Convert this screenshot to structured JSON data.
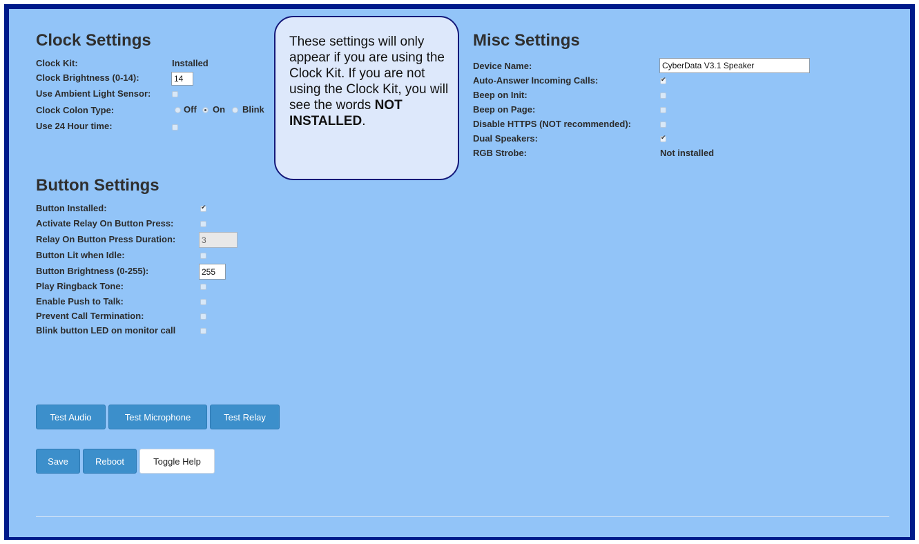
{
  "clock": {
    "title": "Clock Settings",
    "kit_label": "Clock Kit:",
    "kit_value": "Installed",
    "brightness_label": "Clock Brightness (0-14):",
    "brightness_value": "14",
    "ambient_label": "Use Ambient Light Sensor:",
    "ambient_checked": false,
    "colon_label": "Clock Colon Type:",
    "colon_options": [
      "Off",
      "On",
      "Blink"
    ],
    "colon_selected": "On",
    "hour24_label": "Use 24 Hour time:",
    "hour24_checked": false
  },
  "callout": {
    "text": "These settings will only appear if you are using the Clock Kit. If you are not using the Clock Kit, you will see the words ",
    "bold": "NOT INSTALLED",
    "end": "."
  },
  "misc": {
    "title": "Misc Settings",
    "device_name_label": "Device Name:",
    "device_name_value": "CyberData V3.1 Speaker",
    "auto_answer_label": "Auto-Answer Incoming Calls:",
    "auto_answer_checked": true,
    "beep_init_label": "Beep on Init:",
    "beep_init_checked": false,
    "beep_page_label": "Beep on Page:",
    "beep_page_checked": false,
    "disable_https_label": "Disable HTTPS (NOT recommended):",
    "disable_https_checked": false,
    "dual_speakers_label": "Dual Speakers:",
    "dual_speakers_checked": true,
    "rgb_strobe_label": "RGB Strobe:",
    "rgb_strobe_value": "Not installed"
  },
  "button": {
    "title": "Button Settings",
    "installed_label": "Button Installed:",
    "installed_checked": true,
    "relay_press_label": "Activate Relay On Button Press:",
    "relay_press_checked": false,
    "relay_duration_label": "Relay On Button Press Duration:",
    "relay_duration_value": "3",
    "lit_idle_label": "Button Lit when Idle:",
    "lit_idle_checked": false,
    "brightness_label": "Button Brightness (0-255):",
    "brightness_value": "255",
    "ringback_label": "Play Ringback Tone:",
    "ringback_checked": false,
    "ptt_label": "Enable Push to Talk:",
    "ptt_checked": false,
    "prevent_term_label": "Prevent Call Termination:",
    "prevent_term_checked": false,
    "blink_led_label": "Blink button LED on monitor call",
    "blink_led_checked": false
  },
  "actions": {
    "test_audio": "Test Audio",
    "test_microphone": "Test Microphone",
    "test_relay": "Test Relay",
    "save": "Save",
    "reboot": "Reboot",
    "toggle_help": "Toggle Help"
  },
  "colors": {
    "frame": "#001a8a",
    "panel": "#92c4f8",
    "button": "#3c8fcb",
    "callout_border": "#14197a"
  }
}
